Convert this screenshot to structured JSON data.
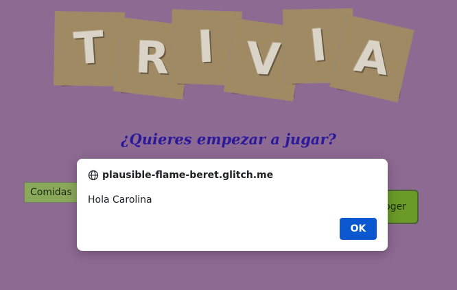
{
  "logo": {
    "letters": [
      "T",
      "R",
      "I",
      "V",
      "I",
      "A"
    ]
  },
  "question": "¿Quieres empezar a jugar?",
  "category_select": {
    "value": "Comidas"
  },
  "choose_button": {
    "label": "Escoger"
  },
  "dialog": {
    "origin": "plausible-flame-beret.glitch.me",
    "message": "Hola Carolina",
    "ok_label": "OK"
  }
}
